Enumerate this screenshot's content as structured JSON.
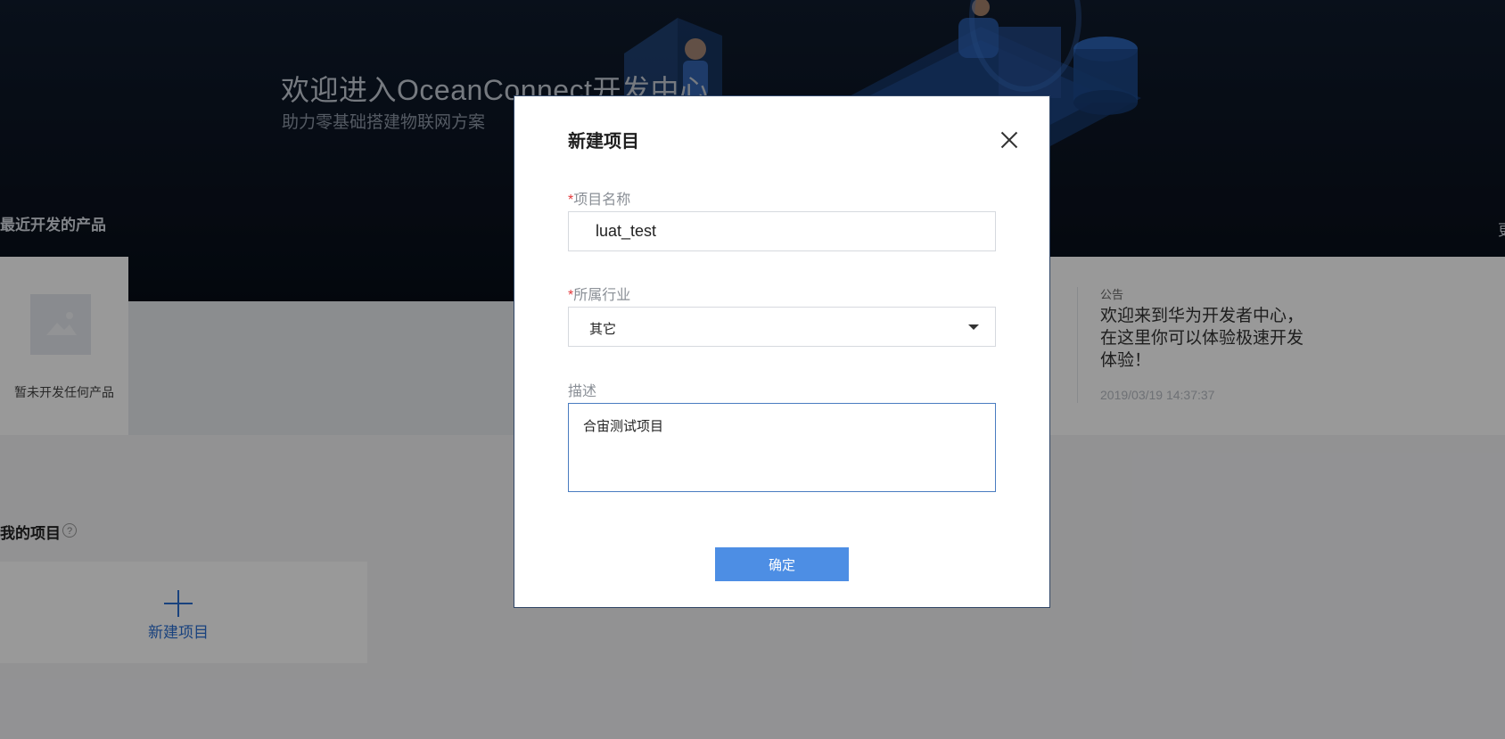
{
  "hero": {
    "title": "欢迎进入OceanConnect开发中心",
    "subtitle": "助力零基础搭建物联网方案"
  },
  "recent": {
    "heading": "最近开发的产品",
    "right_truncated": "更",
    "empty_text": "暂未开发任何产品"
  },
  "notice": {
    "label": "公告",
    "text": "欢迎来到华为开发者中心，在这里你可以体验极速开发体验！",
    "time": "2019/03/19 14:37:37"
  },
  "projects": {
    "heading": "我的项目",
    "help_icon": "?",
    "new_label": "新建项目"
  },
  "modal": {
    "title": "新建项目",
    "required_mark": "*",
    "name_label": "项目名称",
    "name_value": "luat_test",
    "industry_label": "所属行业",
    "industry_value": "其它",
    "desc_label": "描述",
    "desc_value": "合宙测试项目",
    "confirm_label": "确定"
  },
  "colors": {
    "primary": "#4d8ee4",
    "link": "#2b6fd2",
    "required": "#e4393c",
    "hero_bg": "#0b1320"
  }
}
